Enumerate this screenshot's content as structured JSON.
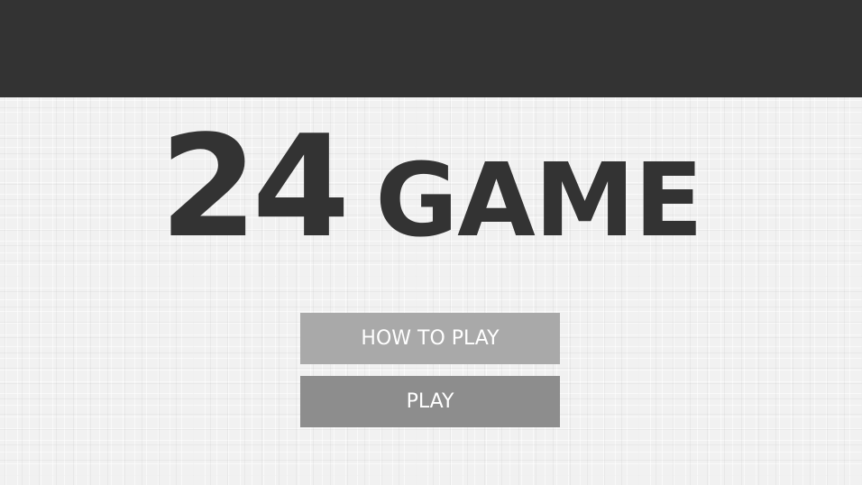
{
  "header": {
    "bar_color": "#333333"
  },
  "title": {
    "number": "24",
    "word": "GAME"
  },
  "menu": {
    "how_to_play_label": "HOW TO PLAY",
    "play_label": "PLAY"
  },
  "colors": {
    "background": "#f1f1f1",
    "title_text": "#333333",
    "how_to_play_button": "#a9a9a9",
    "play_button": "#8d8d8d",
    "button_text": "#ffffff"
  }
}
